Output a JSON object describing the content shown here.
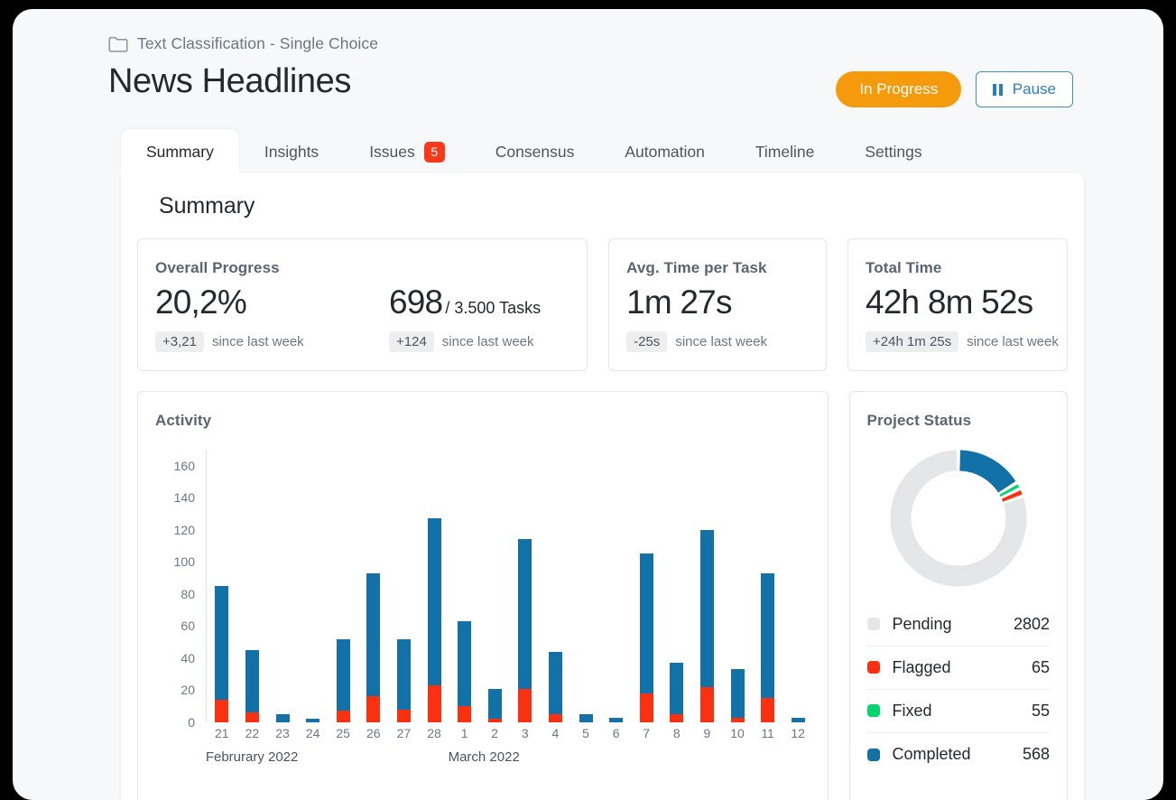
{
  "header": {
    "breadcrumb": "Text Classification - Single Choice",
    "folder_icon": "folder-icon",
    "title": "News Headlines",
    "status_button": "In Progress",
    "pause_button": "Pause",
    "pause_icon": "pause-icon"
  },
  "tabs": [
    {
      "label": "Summary",
      "active": true,
      "badge": null
    },
    {
      "label": "Insights",
      "active": false,
      "badge": null
    },
    {
      "label": "Issues",
      "active": false,
      "badge": "5"
    },
    {
      "label": "Consensus",
      "active": false,
      "badge": null
    },
    {
      "label": "Automation",
      "active": false,
      "badge": null
    },
    {
      "label": "Timeline",
      "active": false,
      "badge": null
    },
    {
      "label": "Settings",
      "active": false,
      "badge": null
    }
  ],
  "section": {
    "title": "Summary"
  },
  "stats": {
    "overall_progress": {
      "label": "Overall Progress",
      "primary": {
        "value": "20,2%",
        "suffix": "",
        "delta": "+3,21",
        "note": "since last week"
      },
      "secondary": {
        "value": "698",
        "suffix": "/ 3.500 Tasks",
        "delta": "+124",
        "note": "since last week"
      }
    },
    "avg_time": {
      "label": "Avg. Time per Task",
      "primary": {
        "value": "1m 27s",
        "suffix": "",
        "delta": "-25s",
        "note": "since last week"
      }
    },
    "total_time": {
      "label": "Total Time",
      "primary": {
        "value": "42h 8m 52s",
        "suffix": "",
        "delta": "+24h 1m 25s",
        "note": "since last week"
      }
    }
  },
  "activity": {
    "title": "Activity"
  },
  "project_status": {
    "title": "Project Status"
  },
  "colors": {
    "blue": "#1272a8",
    "red": "#fa3111",
    "green": "#00d66e",
    "gray": "#e4e6e8",
    "orange": "#f59a0b",
    "badge_red": "#f9391b"
  },
  "chart_data": [
    {
      "type": "bar",
      "title": "Activity",
      "stacked": true,
      "xlabel": "",
      "ylabel": "",
      "ylim": [
        0,
        170
      ],
      "yticks": [
        0,
        20,
        40,
        60,
        80,
        100,
        120,
        140,
        160
      ],
      "grid": false,
      "legend": "none",
      "categories": [
        "21",
        "22",
        "23",
        "24",
        "25",
        "26",
        "27",
        "28",
        "1",
        "2",
        "3",
        "4",
        "5",
        "6",
        "7",
        "8",
        "9",
        "10",
        "11",
        "12"
      ],
      "group_labels": [
        {
          "label": "Februrary 2022",
          "start_index": 0,
          "end_index": 7
        },
        {
          "label": "March 2022",
          "start_index": 8,
          "end_index": 19
        }
      ],
      "series": [
        {
          "name": "Flagged",
          "color": "#fa3111",
          "values": [
            14,
            6,
            0,
            0,
            7,
            16,
            8,
            23,
            10,
            2,
            21,
            5,
            0,
            0,
            18,
            5,
            22,
            3,
            15,
            0
          ]
        },
        {
          "name": "Completed",
          "color": "#1272a8",
          "values": [
            71,
            39,
            5,
            2,
            45,
            77,
            44,
            104,
            53,
            19,
            93,
            39,
            5,
            3,
            87,
            32,
            98,
            30,
            78,
            3
          ]
        }
      ],
      "totals": [
        85,
        45,
        5,
        2,
        52,
        93,
        52,
        127,
        63,
        21,
        114,
        44,
        5,
        3,
        105,
        37,
        120,
        33,
        93,
        3
      ]
    },
    {
      "type": "pie",
      "title": "Project Status",
      "donut": true,
      "legend": "below",
      "labels": [
        "Pending",
        "Flagged",
        "Fixed",
        "Completed"
      ],
      "values": [
        2802,
        65,
        55,
        568
      ],
      "colors": [
        "#e4e6e8",
        "#fa3111",
        "#00d66e",
        "#1272a8"
      ],
      "order_clockwise_from_top": [
        "Completed",
        "Fixed",
        "Flagged",
        "Pending"
      ]
    }
  ]
}
